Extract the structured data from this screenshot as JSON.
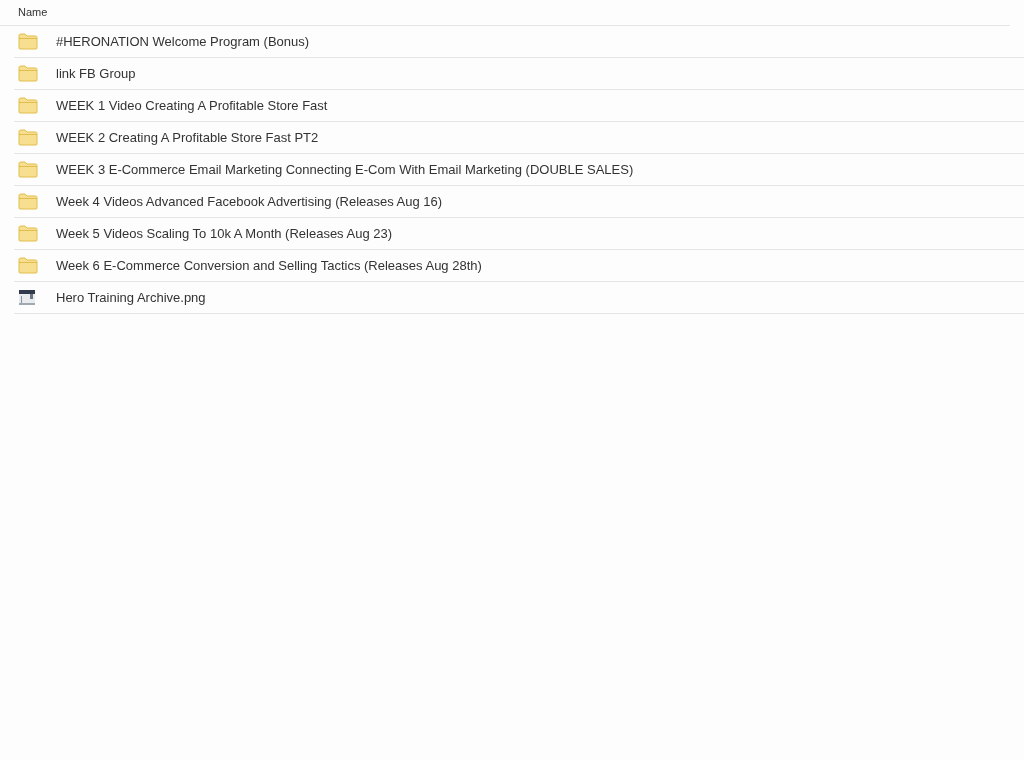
{
  "table": {
    "columns": [
      "Name"
    ],
    "rows": [
      {
        "kind": "folder",
        "name": "#HERONATION Welcome Program (Bonus)"
      },
      {
        "kind": "folder",
        "name": "link FB Group"
      },
      {
        "kind": "folder",
        "name": "WEEK 1 Video Creating A Profitable Store Fast"
      },
      {
        "kind": "folder",
        "name": "WEEK 2 Creating A Profitable Store Fast PT2"
      },
      {
        "kind": "folder",
        "name": "WEEK 3 E-Commerce Email Marketing Connecting E-Com With Email Marketing (DOUBLE SALES)"
      },
      {
        "kind": "folder",
        "name": "Week 4 Videos Advanced Facebook Advertising (Releases Aug 16)"
      },
      {
        "kind": "folder",
        "name": "Week 5 Videos Scaling To 10k A Month (Releases Aug 23)"
      },
      {
        "kind": "folder",
        "name": "Week 6 E-Commerce Conversion and Selling Tactics (Releases Aug 28th)"
      },
      {
        "kind": "image",
        "name": "Hero Training Archive.png"
      }
    ]
  }
}
